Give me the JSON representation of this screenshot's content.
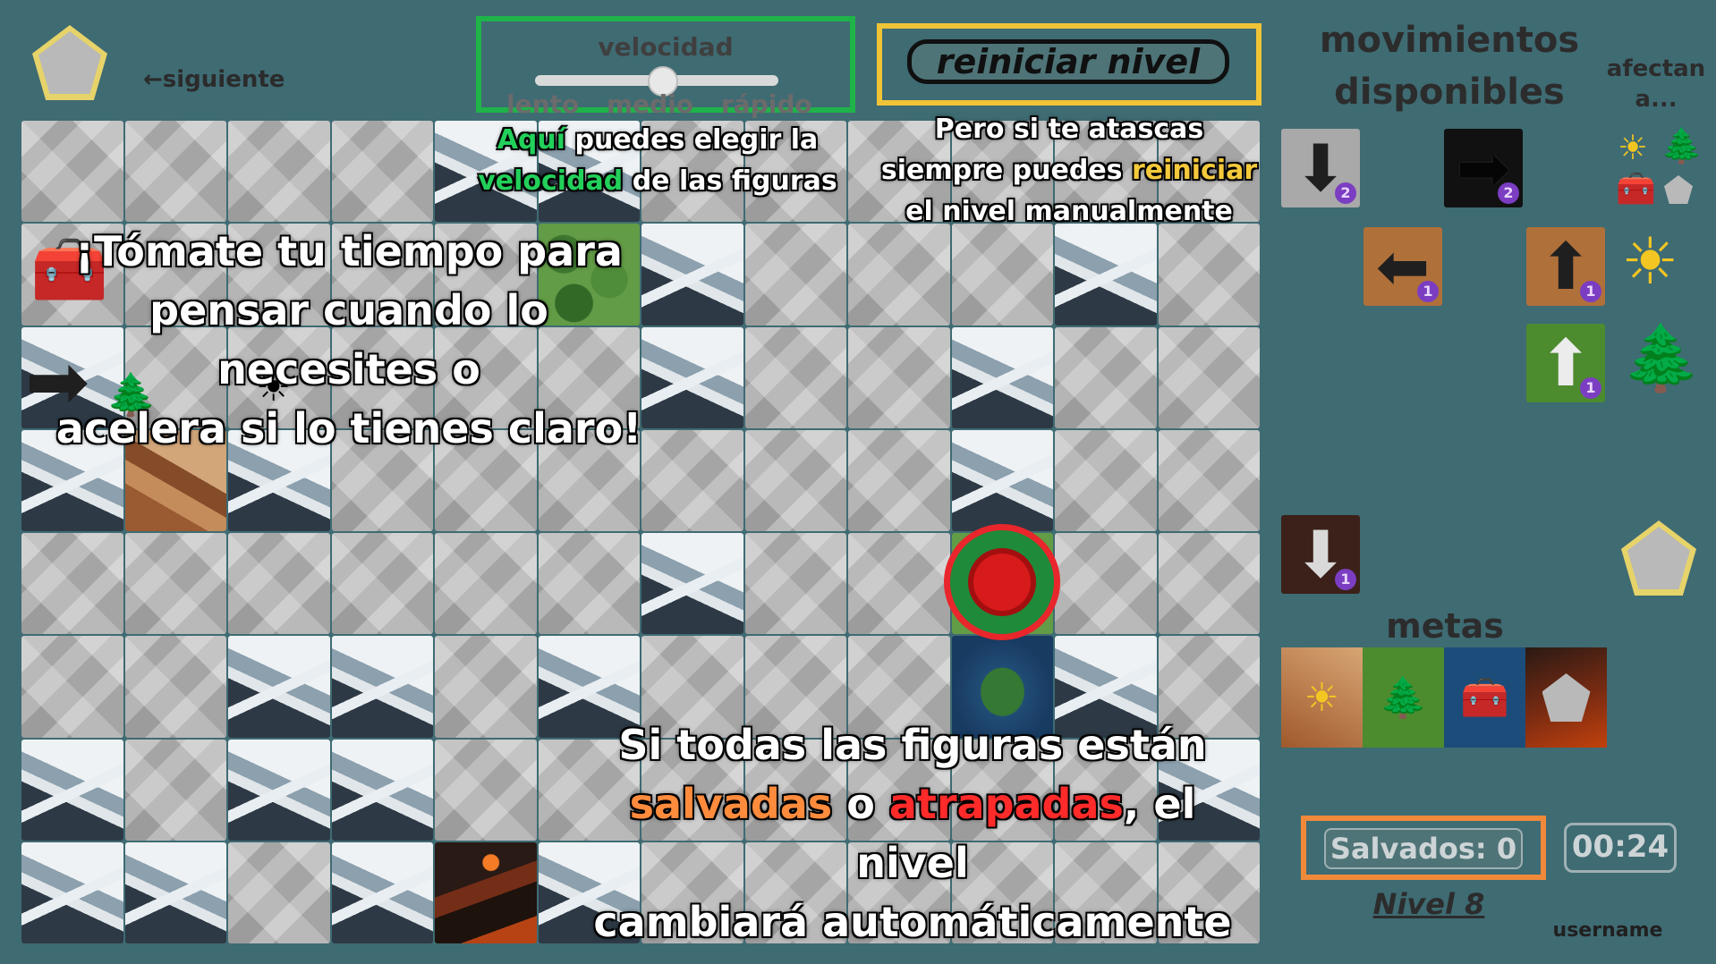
{
  "header": {
    "next_label": "←siguiente",
    "speed": {
      "title": "velocidad",
      "options": [
        "lento",
        "medio",
        "rápido"
      ],
      "selected": "medio"
    },
    "reset_label": "reiniciar nivel"
  },
  "sidebar": {
    "moves_title_line1": "movimientos",
    "moves_title_line2": "disponibles",
    "affects_label_line1": "afectan",
    "affects_label_line2": "a...",
    "moves": [
      {
        "direction": "down",
        "count": "2",
        "terrain": "mountain"
      },
      {
        "direction": "right",
        "count": "2",
        "terrain": "dark"
      },
      {
        "direction": "left",
        "count": "1",
        "terrain": "desert"
      },
      {
        "direction": "up",
        "count": "1",
        "terrain": "desert"
      },
      {
        "direction": "up",
        "count": "1",
        "terrain": "forest"
      },
      {
        "direction": "down",
        "count": "1",
        "terrain": "volcano"
      }
    ],
    "goals_title": "metas",
    "counter_label": "Salvados: 0",
    "timer": "00:24",
    "level": "Nivel 8",
    "username": "username"
  },
  "tutorial": {
    "speed_hint_a": "Aquí",
    "speed_hint_b": " puedes elegir la",
    "speed_hint_c": "velocidad",
    "speed_hint_d": " de las figuras",
    "reset_hint_line1": "Pero si te atascas",
    "reset_hint_line2a": "siempre puedes ",
    "reset_hint_line2b": "reiniciar",
    "reset_hint_line3": "el nivel manualmente",
    "think_line1": "¡Tómate tu tiempo para",
    "think_line2": "pensar cuando lo necesites o",
    "think_line3": "acelera si lo tienes claro!",
    "auto_line1": "Si todas las figuras están",
    "auto_salvadas": "salvadas",
    "auto_o": " o ",
    "auto_atrapadas": "atrapadas",
    "auto_line2_end": ", el nivel",
    "auto_line3": "cambiará automáticamente"
  },
  "colors": {
    "background": "#3f6b73",
    "speed_highlight": "#1fb34a",
    "reset_highlight": "#f0c437",
    "counter_highlight": "#f08a3a",
    "target_ring": "#e8262b"
  },
  "icons": {
    "sun": "sun-icon",
    "tree": "tree-icon",
    "chest": "chest-icon",
    "rock": "pentagon-rock-icon"
  },
  "board": {
    "rows": 8,
    "cols": 12
  }
}
